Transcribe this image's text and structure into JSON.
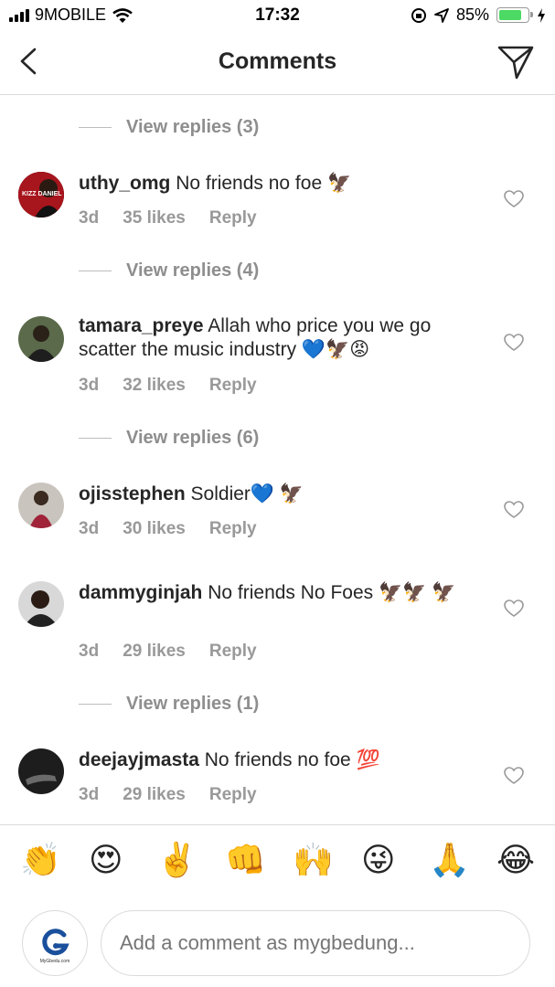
{
  "status_bar": {
    "carrier": "9MOBILE",
    "time": "17:32",
    "battery_percent": "85%",
    "battery_level": 0.85
  },
  "header": {
    "title": "Comments"
  },
  "comments": [
    {
      "view_replies_above": "View replies (3)",
      "username": "uthy_omg",
      "text": "No friends no foe 🦅",
      "age": "3d",
      "likes": "35 likes",
      "reply_label": "Reply",
      "avatar_text": "KIZZ DANIEL"
    },
    {
      "view_replies_above": "View replies (4)",
      "username": "tamara_preye",
      "text": "Allah who price you we go scatter the music  industry 💙🦅😡",
      "age": "3d",
      "likes": "32 likes",
      "reply_label": "Reply"
    },
    {
      "view_replies_above": "View replies (6)",
      "username": "ojisstephen",
      "text": "Soldier💙 🦅",
      "age": "3d",
      "likes": "30 likes",
      "reply_label": "Reply"
    },
    {
      "username": "dammyginjah",
      "text": "No friends No Foes 🦅🦅 🦅",
      "age": "3d",
      "likes": "29 likes",
      "reply_label": "Reply"
    },
    {
      "view_replies_above": "View replies (1)",
      "username": "deejayjmasta",
      "text": "No friends no foe 💯",
      "age": "3d",
      "likes": "29 likes",
      "reply_label": "Reply"
    }
  ],
  "emoji_bar": [
    "👏",
    "😍",
    "✌️",
    "👊",
    "🙌",
    "😜",
    "🙏",
    "😂"
  ],
  "composer": {
    "placeholder": "Add a comment as mygbedung...",
    "avatar_label": "MyGbedu.com"
  },
  "colors": {
    "text": "#262626",
    "muted": "#999999",
    "divider": "#dbdbdb",
    "battery": "#4cd964"
  }
}
